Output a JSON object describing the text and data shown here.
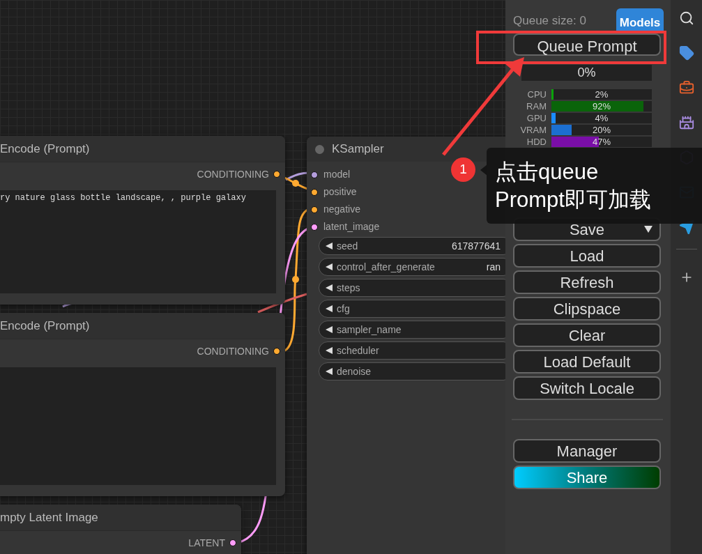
{
  "canvas": {
    "nodes": [
      {
        "kind": "prompt",
        "title": "Encode (Prompt)",
        "outputs": [
          {
            "label": "CONDITIONING",
            "color": "#ffa931"
          }
        ],
        "text": "ry nature glass bottle landscape, , purple galaxy"
      },
      {
        "kind": "prompt",
        "title": "Encode (Prompt)",
        "outputs": [
          {
            "label": "CONDITIONING",
            "color": "#ffa931"
          }
        ]
      },
      {
        "kind": "latent",
        "title": "mpty Latent Image",
        "outputs": [
          {
            "label": "LATENT",
            "color": "#ff9cf9"
          }
        ]
      }
    ],
    "ksampler": {
      "title": "KSampler",
      "inputs": [
        {
          "label": "model",
          "color": "#b39ddb"
        },
        {
          "label": "positive",
          "color": "#ffa931"
        },
        {
          "label": "negative",
          "color": "#ffa931"
        },
        {
          "label": "latent_image",
          "color": "#ff9cf9"
        }
      ],
      "widgets": [
        {
          "label": "seed",
          "value": "617877641"
        },
        {
          "label": "control_after_generate",
          "value": "ran"
        },
        {
          "label": "steps"
        },
        {
          "label": "cfg"
        },
        {
          "label": "sampler_name"
        },
        {
          "label": "scheduler"
        },
        {
          "label": "denoise"
        }
      ]
    }
  },
  "panel": {
    "queue_size": "Queue size: 0",
    "models_button": "Models",
    "queue_prompt_button": "Queue Prompt",
    "progress": {
      "reading": "0%",
      "level": 0
    },
    "monitors": [
      {
        "label": "CPU",
        "reading": "2%",
        "level": 0.02,
        "color": "#0aa30a"
      },
      {
        "label": "RAM",
        "reading": "92%",
        "level": 0.92,
        "color": "#0a640a"
      },
      {
        "label": "GPU",
        "reading": "4%",
        "level": 0.04,
        "color": "#1a8cff"
      },
      {
        "label": "VRAM",
        "reading": "20%",
        "level": 0.2,
        "color": "#1c6fd0"
      },
      {
        "label": "HDD",
        "reading": "47%",
        "level": 0.47,
        "color": "#7a0ea8"
      }
    ],
    "buttons": [
      {
        "label": "Save",
        "kind": "dropdown"
      },
      {
        "label": "Load",
        "kind": "plain"
      },
      {
        "label": "Refresh",
        "kind": "plain"
      },
      {
        "label": "Clipspace",
        "kind": "plain"
      },
      {
        "label": "Clear",
        "kind": "plain"
      },
      {
        "label": "Load Default",
        "kind": "plain"
      },
      {
        "label": "Switch Locale",
        "kind": "plain"
      }
    ],
    "extra_buttons": [
      {
        "label": "Manager",
        "kind": "plain"
      },
      {
        "label": "Share",
        "kind": "gradient"
      }
    ]
  },
  "annotation": {
    "badge": "1",
    "lines": [
      "点击queue",
      "Prompt即可加载"
    ]
  }
}
